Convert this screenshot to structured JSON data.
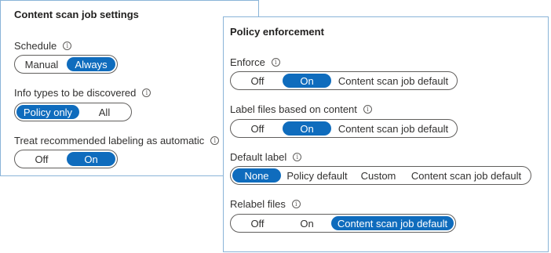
{
  "content_scan_settings": {
    "title": "Content scan job settings",
    "info_icon_glyph": "i",
    "schedule": {
      "label": "Schedule",
      "options": [
        "Manual",
        "Always"
      ],
      "selected": "Always"
    },
    "info_types": {
      "label": "Info types to be discovered",
      "options": [
        "Policy only",
        "All"
      ],
      "selected": "Policy only"
    },
    "treat_recommended": {
      "label": "Treat recommended labeling as automatic",
      "options": [
        "Off",
        "On"
      ],
      "selected": "On"
    }
  },
  "policy_enforcement": {
    "title": "Policy enforcement",
    "enforce": {
      "label": "Enforce",
      "options": [
        "Off",
        "On",
        "Content scan job default"
      ],
      "selected": "On"
    },
    "label_files": {
      "label": "Label files based on content",
      "options": [
        "Off",
        "On",
        "Content scan job default"
      ],
      "selected": "On"
    },
    "default_label": {
      "label": "Default label",
      "options": [
        "None",
        "Policy default",
        "Custom",
        "Content scan job default"
      ],
      "selected": "None"
    },
    "relabel_files": {
      "label": "Relabel files",
      "options": [
        "Off",
        "On",
        "Content scan job default"
      ],
      "selected": "Content scan job default"
    }
  },
  "colors": {
    "accent": "#0f6cbd",
    "panel_border": "#8ab4d8"
  }
}
